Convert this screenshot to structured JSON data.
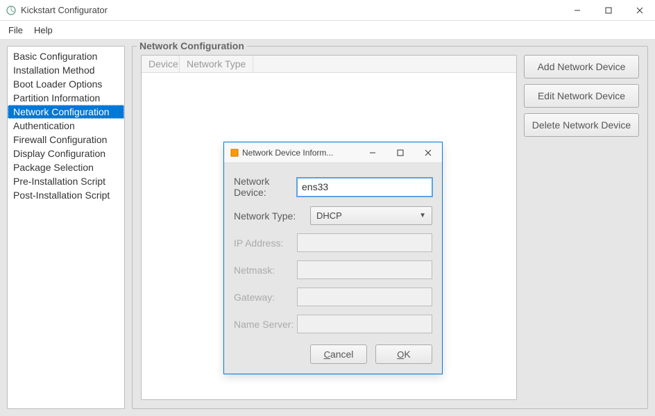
{
  "window": {
    "title": "Kickstart Configurator"
  },
  "menu": {
    "file": "File",
    "help": "Help"
  },
  "sidebar": {
    "items": [
      "Basic Configuration",
      "Installation Method",
      "Boot Loader Options",
      "Partition Information",
      "Network Configuration",
      "Authentication",
      "Firewall Configuration",
      "Display Configuration",
      "Package Selection",
      "Pre-Installation Script",
      "Post-Installation Script"
    ],
    "selected_index": 4
  },
  "content": {
    "fieldset_title": "Network Configuration",
    "columns": {
      "device": "Device",
      "network_type": "Network Type"
    },
    "buttons": {
      "add": "Add Network Device",
      "edit": "Edit Network Device",
      "delete": "Delete Network Device"
    }
  },
  "dialog": {
    "title": "Network Device Inform...",
    "labels": {
      "network_device": "Network Device:",
      "network_type": "Network Type:",
      "ip_address": "IP Address:",
      "netmask": "Netmask:",
      "gateway": "Gateway:",
      "name_server": "Name Server:"
    },
    "values": {
      "network_device": "ens33",
      "network_type": "DHCP",
      "ip_address": "",
      "netmask": "",
      "gateway": "",
      "name_server": ""
    },
    "buttons": {
      "cancel": "Cancel",
      "ok": "OK"
    }
  }
}
